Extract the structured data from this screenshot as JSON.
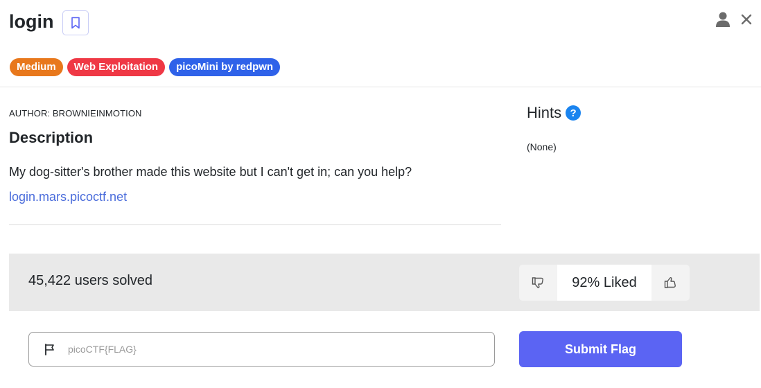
{
  "challenge": {
    "title": "login",
    "tags": [
      {
        "label": "Medium",
        "color": "#e8781c"
      },
      {
        "label": "Web Exploitation",
        "color": "#ef3845"
      },
      {
        "label": "picoMini by redpwn",
        "color": "#2f62e9"
      }
    ],
    "author": "AUTHOR: BROWNIEINMOTION",
    "description_heading": "Description",
    "description_text": "My dog-sitter's brother made this website but I can't get in; can you help?",
    "link_text": "login.mars.picoctf.net"
  },
  "hints": {
    "title": "Hints",
    "help_symbol": "?",
    "content": "(None)"
  },
  "stats": {
    "solved": "45,422 users solved",
    "liked": "92% Liked"
  },
  "flag_form": {
    "placeholder": "picoCTF{FLAG}",
    "submit_label": "Submit Flag"
  },
  "icons": {
    "bookmark": "bookmark-icon",
    "user": "user-icon",
    "close": "close-icon",
    "help": "help-icon",
    "thumbs_down": "thumbs-down-icon",
    "thumbs_up": "thumbs-up-icon",
    "flag": "flag-icon"
  },
  "colors": {
    "accent": "#5b64f3",
    "link": "#4a6cdb",
    "help": "#1a84ef"
  }
}
